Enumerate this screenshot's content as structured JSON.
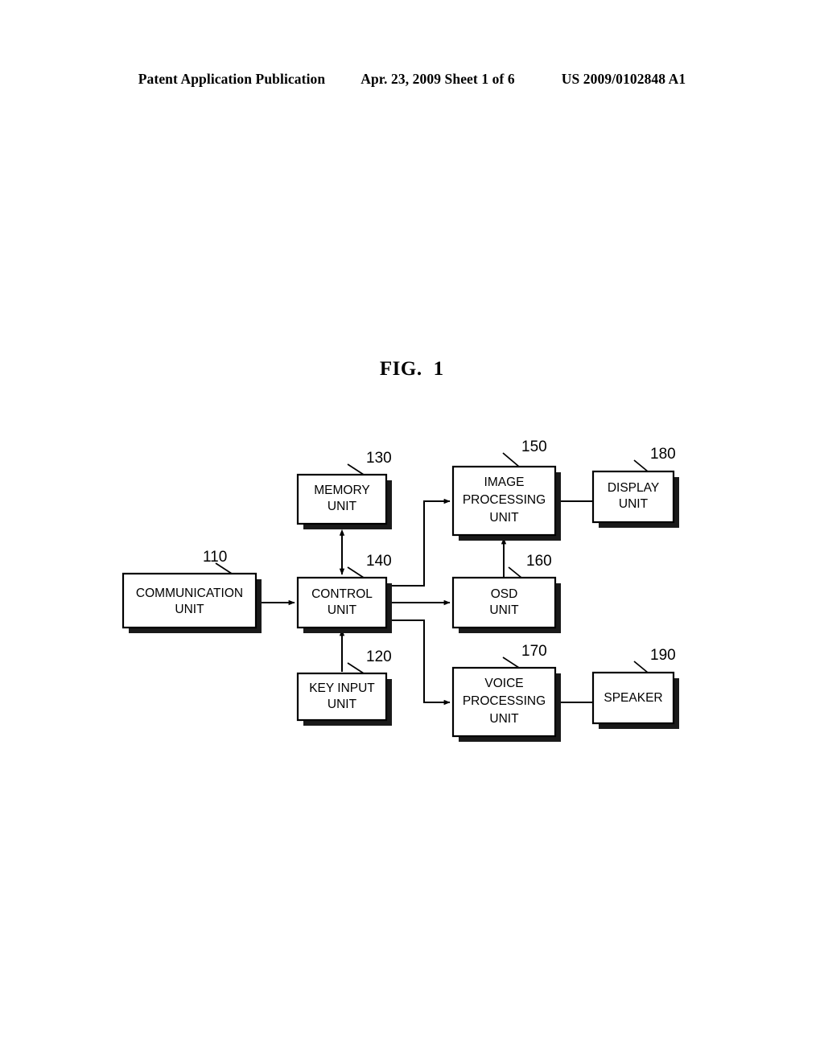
{
  "header": {
    "publication": "Patent Application Publication",
    "date_sheet": "Apr. 23, 2009  Sheet 1 of 6",
    "patent_number": "US 2009/0102848 A1"
  },
  "figure": {
    "label": "FIG.",
    "number": "1"
  },
  "diagram": {
    "blocks": [
      {
        "id": "communication",
        "ref": "110",
        "lines": [
          "COMMUNICATION",
          "UNIT"
        ]
      },
      {
        "id": "key-input",
        "ref": "120",
        "lines": [
          "KEY INPUT",
          "UNIT"
        ]
      },
      {
        "id": "memory",
        "ref": "130",
        "lines": [
          "MEMORY",
          "UNIT"
        ]
      },
      {
        "id": "control",
        "ref": "140",
        "lines": [
          "CONTROL",
          "UNIT"
        ]
      },
      {
        "id": "image-proc",
        "ref": "150",
        "lines": [
          "IMAGE",
          "PROCESSING",
          "UNIT"
        ]
      },
      {
        "id": "osd",
        "ref": "160",
        "lines": [
          "OSD",
          "UNIT"
        ]
      },
      {
        "id": "voice-proc",
        "ref": "170",
        "lines": [
          "VOICE",
          "PROCESSING",
          "UNIT"
        ]
      },
      {
        "id": "display",
        "ref": "180",
        "lines": [
          "DISPLAY",
          "UNIT"
        ]
      },
      {
        "id": "speaker",
        "ref": "190",
        "lines": [
          "SPEAKER"
        ]
      }
    ],
    "connections": [
      {
        "from": "communication",
        "to": "control",
        "arrows": "both"
      },
      {
        "from": "memory",
        "to": "control",
        "arrows": "both"
      },
      {
        "from": "key-input",
        "to": "control",
        "arrows": "to-control"
      },
      {
        "from": "control",
        "to": "image-proc",
        "arrows": "forward"
      },
      {
        "from": "control",
        "to": "osd",
        "arrows": "forward"
      },
      {
        "from": "control",
        "to": "voice-proc",
        "arrows": "forward"
      },
      {
        "from": "osd",
        "to": "image-proc",
        "arrows": "forward"
      },
      {
        "from": "image-proc",
        "to": "display",
        "arrows": "none"
      },
      {
        "from": "voice-proc",
        "to": "speaker",
        "arrows": "none"
      }
    ]
  },
  "colors": {
    "ink": "#000000",
    "paper": "#ffffff",
    "shadow": "#1a1a1a"
  }
}
